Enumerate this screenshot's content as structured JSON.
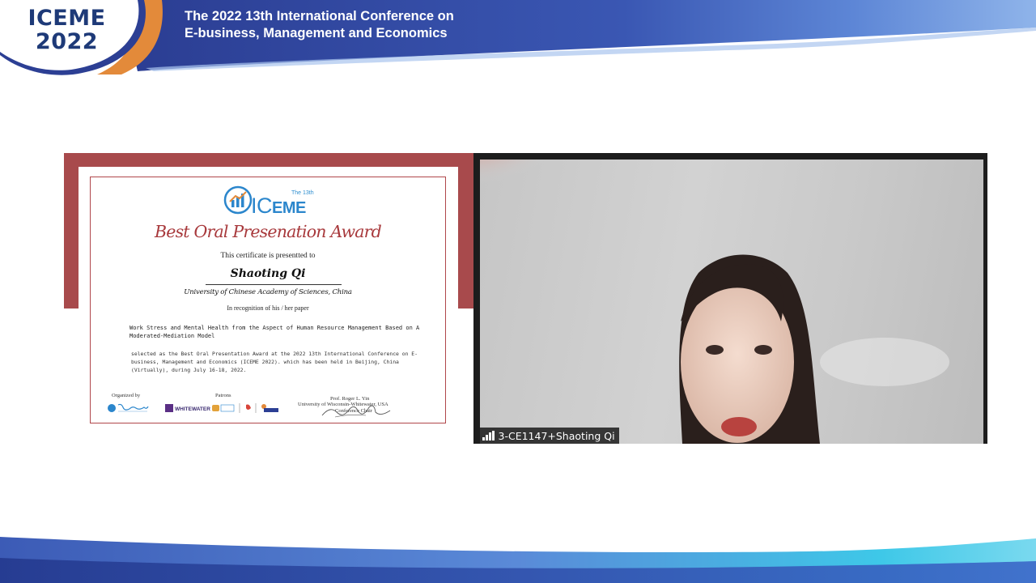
{
  "header": {
    "logo_line1": "ICEME",
    "logo_line2": "2022",
    "title_line1": "The 2022 13th International Conference on",
    "title_line2": "E-business, Management and Economics"
  },
  "certificate": {
    "logo_superscript": "The 13th",
    "logo_text_big": "IC",
    "logo_text_small": "EME",
    "award_title": "Best Oral Presenation Award",
    "presented_line": "This  certificate is presentted to",
    "recipient": "Shaoting Qi",
    "university": "University of Chinese Academy of Sciences, China",
    "recognition": "In recognition of his / her paper",
    "paper_title": "Work Stress and Mental Health from the Aspect of Human Resource Management Based on A Moderated-Mediation Model",
    "statement": "selected as the Best Oral Presentation Award at the 2022 13th International Conference on E-business, Management and Economics (ICEME 2022). which has been held in Beijing, China (Virtually), during July 16-18, 2022.",
    "organized_by": "Organized by",
    "patrons": "Patrons",
    "signer_name": "Prof. Roger L. Yin",
    "signer_univ": "University of Wisconsin-Whitewater, USA",
    "signer_role": "Conference Chair",
    "patron_logo_text": "WHITEWATER"
  },
  "video": {
    "participant_label": "3-CE1147+Shaoting Qi"
  },
  "colors": {
    "banner_blue": "#2c3f94",
    "accent_orange": "#e38a3a",
    "certificate_red": "#a84a4c"
  }
}
